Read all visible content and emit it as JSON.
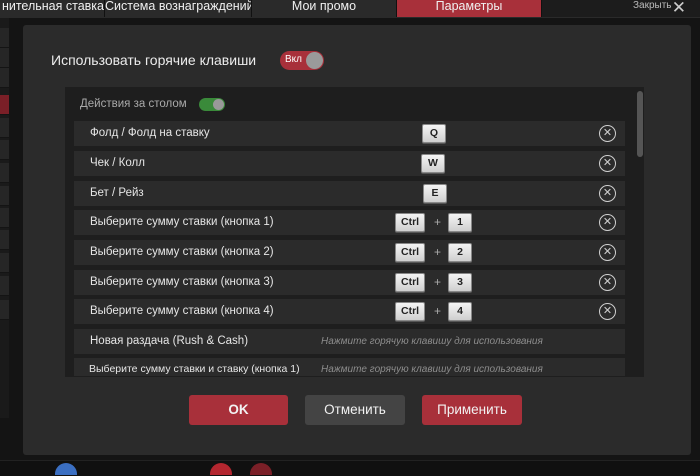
{
  "tabs": [
    {
      "label": "нительная ставка",
      "active": false
    },
    {
      "label": "Система вознаграждений",
      "active": false
    },
    {
      "label": "Мои промо",
      "active": false
    },
    {
      "label": "Параметры",
      "active": true
    }
  ],
  "close": {
    "label": "Закрыть",
    "icon": "close-icon"
  },
  "hotkeys": {
    "label": "Использовать горячие клавиши",
    "toggle_label": "Вкл",
    "enabled": true
  },
  "section": {
    "title": "Действия за столом",
    "enabled": true
  },
  "rows": [
    {
      "label": "Фолд / Фолд на ставку",
      "keys": [
        "Q"
      ]
    },
    {
      "label": "Чек / Колл",
      "keys": [
        "W"
      ]
    },
    {
      "label": "Бет / Рейз",
      "keys": [
        "E"
      ]
    },
    {
      "label": "Выберите сумму ставки (кнопка 1)",
      "keys": [
        "Ctrl",
        "1"
      ]
    },
    {
      "label": "Выберите сумму ставки (кнопка 2)",
      "keys": [
        "Ctrl",
        "2"
      ]
    },
    {
      "label": "Выберите сумму ставки (кнопка 3)",
      "keys": [
        "Ctrl",
        "3"
      ]
    },
    {
      "label": "Выберите сумму ставки (кнопка 4)",
      "keys": [
        "Ctrl",
        "4"
      ]
    },
    {
      "label": "Новая раздача (Rush & Cash)",
      "hint": "Нажмите горячую клавишу для использования"
    },
    {
      "label": "Выберите сумму ставки и ставку (кнопка 1)",
      "hint": "Нажмите горячую клавишу для использования"
    }
  ],
  "key_plus": "+",
  "clear_symbol": "✕",
  "buttons": {
    "ok": "OK",
    "cancel": "Отменить",
    "apply": "Применить"
  },
  "colors": {
    "accent": "#a8303a",
    "toggle_on_green": "#3a8a3a"
  }
}
